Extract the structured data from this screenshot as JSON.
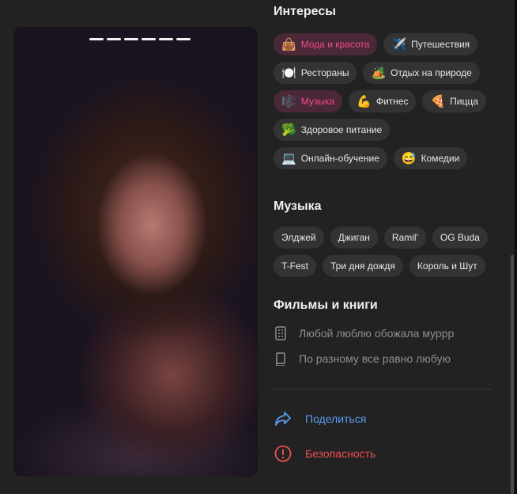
{
  "interests": {
    "title": "Интересы",
    "chips": [
      {
        "label": "Мода и красота",
        "icon": "👜",
        "selected": true
      },
      {
        "label": "Путешествия",
        "icon": "✈️",
        "selected": false
      },
      {
        "label": "Рестораны",
        "icon": "🍽️",
        "selected": false
      },
      {
        "label": "Отдых на природе",
        "icon": "🏕️",
        "selected": false
      },
      {
        "label": "Музыка",
        "icon": "🎼",
        "selected": true
      },
      {
        "label": "Фитнес",
        "icon": "💪",
        "selected": false
      },
      {
        "label": "Пицца",
        "icon": "🍕",
        "selected": false
      },
      {
        "label": "Здоровое питание",
        "icon": "🥦",
        "selected": false
      },
      {
        "label": "Онлайн-обучение",
        "icon": "💻",
        "selected": false
      },
      {
        "label": "Комедии",
        "icon": "😅",
        "selected": false
      }
    ]
  },
  "music": {
    "title": "Музыка",
    "chips": [
      "Элджей",
      "Джиган",
      "Ramil'",
      "OG Buda",
      "T-Fest",
      "Три дня дождя",
      "Король и Шут"
    ]
  },
  "films_books": {
    "title": "Фильмы и книги",
    "films": "Любой люблю обожала муррр",
    "books": "По разному все равно любую"
  },
  "actions": {
    "share_label": "Поделиться",
    "share_color": "#5b9cf0",
    "safety_label": "Безопасность",
    "safety_color": "#ee4f4f"
  },
  "photo": {
    "story_segments": 6
  }
}
